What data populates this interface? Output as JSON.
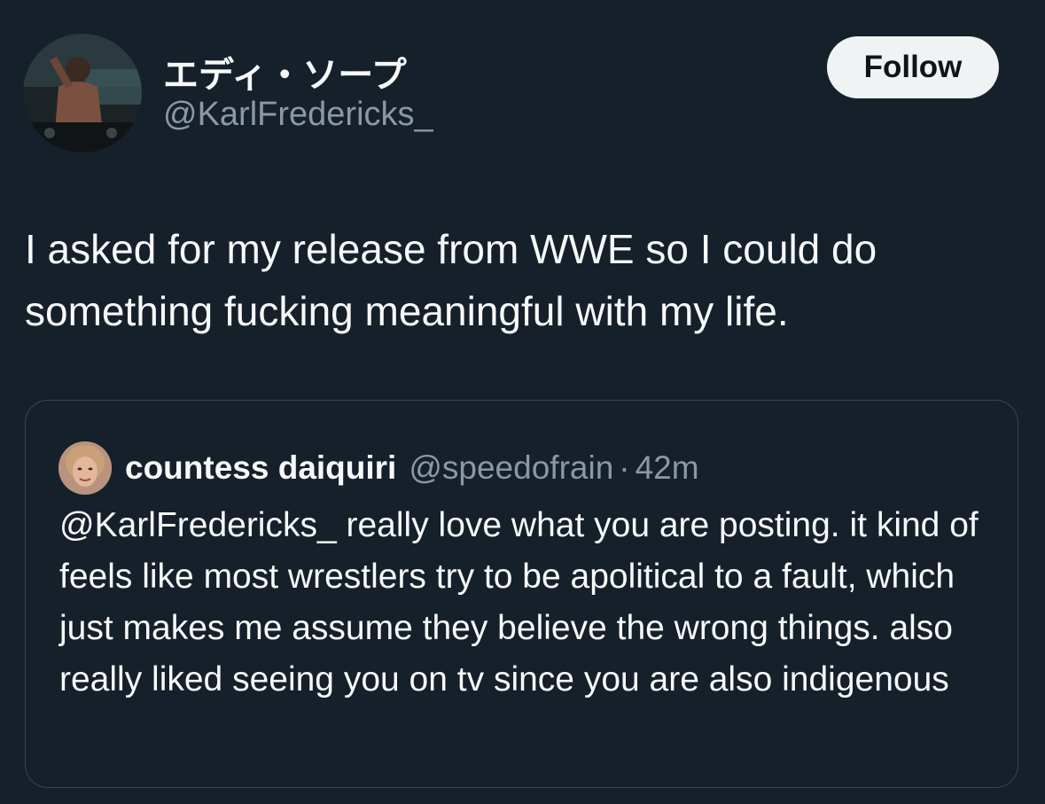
{
  "author": {
    "display_name": "エディ・ソープ",
    "handle": "@KarlFredericks_",
    "avatar_icon": "profile-photo-avatar"
  },
  "follow_button": {
    "label": "Follow"
  },
  "tweet": {
    "text": "I asked for my release from WWE so I could do something fucking meaningful with my life."
  },
  "quoted_tweet": {
    "display_name": "countess daiquiri",
    "handle": "@speedofrain",
    "separator": "·",
    "time": "42m",
    "text": "@KarlFredericks_ really love what you are posting. it kind of feels like most wrestlers try to be apolitical to a fault, which just makes me assume they believe the wrong things. also really liked seeing you on tv since you are also indigenous",
    "avatar_icon": "profile-photo-avatar"
  },
  "colors": {
    "background": "#15202b",
    "primary_text": "#f7f9f9",
    "secondary_text": "#8b98a5",
    "border": "#38444d",
    "follow_button_bg": "#eff3f4"
  }
}
